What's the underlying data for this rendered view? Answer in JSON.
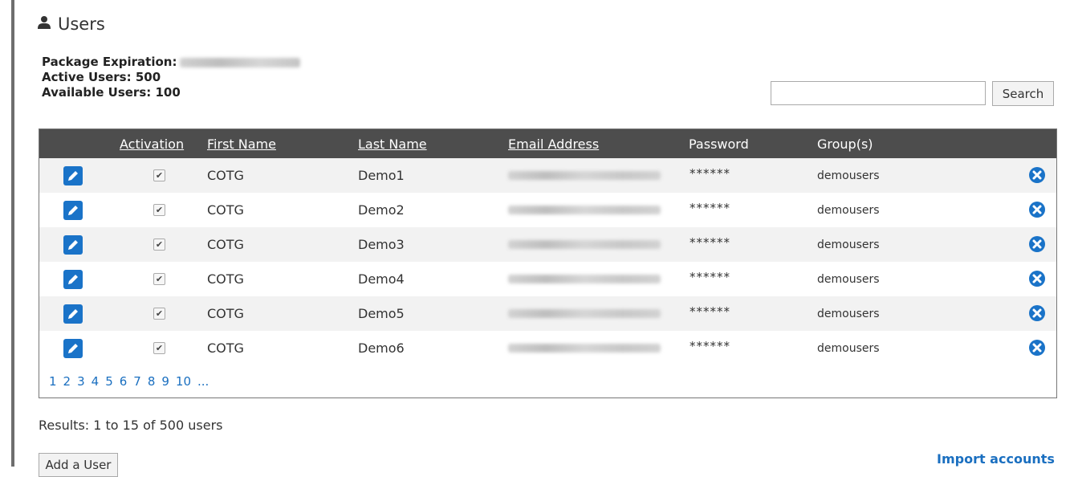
{
  "header": {
    "title": "Users"
  },
  "info": {
    "package_expiration_label": "Package Expiration:",
    "active_users_label": "Active Users: 500",
    "available_users_label": "Available Users: 100"
  },
  "search": {
    "button_label": "Search",
    "placeholder": "",
    "value": ""
  },
  "table": {
    "columns": [
      "Activation",
      "First Name",
      "Last Name",
      "Email Address",
      "Password",
      "Group(s)"
    ],
    "rows": [
      {
        "activated": true,
        "first_name": "COTG",
        "last_name": "Demo1",
        "password": "******",
        "group": "demousers"
      },
      {
        "activated": true,
        "first_name": "COTG",
        "last_name": "Demo2",
        "password": "******",
        "group": "demousers"
      },
      {
        "activated": true,
        "first_name": "COTG",
        "last_name": "Demo3",
        "password": "******",
        "group": "demousers"
      },
      {
        "activated": true,
        "first_name": "COTG",
        "last_name": "Demo4",
        "password": "******",
        "group": "demousers"
      },
      {
        "activated": true,
        "first_name": "COTG",
        "last_name": "Demo5",
        "password": "******",
        "group": "demousers"
      },
      {
        "activated": true,
        "first_name": "COTG",
        "last_name": "Demo6",
        "password": "******",
        "group": "demousers"
      }
    ]
  },
  "pagination": {
    "pages": [
      "1",
      "2",
      "3",
      "4",
      "5",
      "6",
      "7",
      "8",
      "9",
      "10",
      "..."
    ],
    "current": "1"
  },
  "results_text": "Results: 1 to 15 of 500 users",
  "actions": {
    "add_user_label": "Add a User",
    "import_label": "Import accounts"
  },
  "icons": {
    "title": "user-icon",
    "edit": "pencil-icon",
    "delete": "close-circle-icon",
    "activation": "checkbox-icon"
  },
  "colors": {
    "accent": "#1a73c8",
    "header_bg": "#4d4d4d",
    "link": "#1a6fc0"
  }
}
